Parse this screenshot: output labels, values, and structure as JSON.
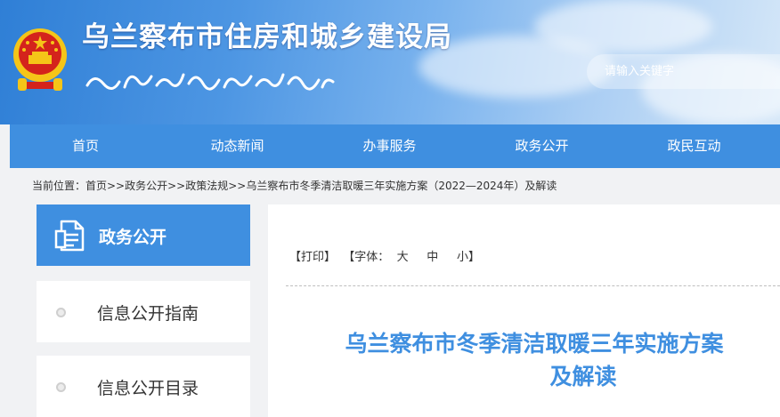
{
  "header": {
    "site_title": "乌兰察布市住房和城乡建设局",
    "search_placeholder": "请输入关键字"
  },
  "nav": {
    "items": [
      "首页",
      "动态新闻",
      "办事服务",
      "政务公开",
      "政民互动"
    ]
  },
  "breadcrumb": {
    "text": "当前位置：首页>>政务公开>>政策法规>>乌兰察布市冬季清洁取暖三年实施方案（2022—2024年）及解读"
  },
  "sidebar": {
    "header": "政务公开",
    "items": [
      "信息公开指南",
      "信息公开目录"
    ]
  },
  "article": {
    "print": "【打印】",
    "font_label": "【字体：",
    "font_large": "大",
    "font_medium": "中",
    "font_small": "小】",
    "title_line1": "乌兰察布市冬季清洁取暖三年实施方案",
    "title_line2": "及解读"
  },
  "colors": {
    "primary": "#3f8fe0",
    "emblem_red": "#d4231c",
    "emblem_gold": "#f5c518"
  }
}
